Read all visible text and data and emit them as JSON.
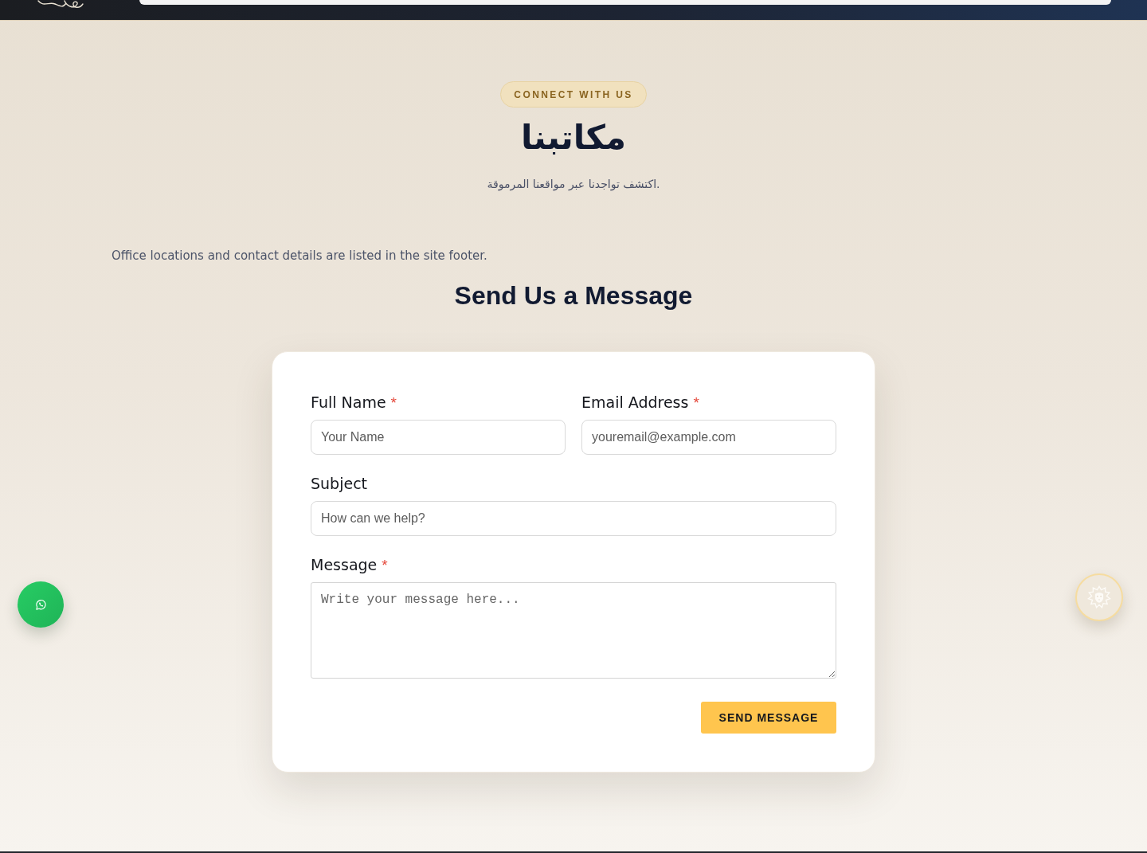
{
  "hero": {
    "badge": "CONNECT WITH US",
    "title": "مكاتبنا",
    "subtitle": "اكتشف تواجدنا عبر مواقعنا المرموقة."
  },
  "note": "Office locations and contact details are listed in the site footer.",
  "form": {
    "title": "Send Us a Message",
    "rows": [
      [
        {
          "kind": "input",
          "label": "Full Name",
          "required_mark": "*",
          "placeholder": "Your Name"
        },
        {
          "kind": "input",
          "label": "Email Address",
          "required_mark": "*",
          "placeholder": "youremail@example.com"
        }
      ],
      [
        {
          "kind": "input",
          "label": "Subject",
          "placeholder": "How can we help?"
        }
      ],
      [
        {
          "kind": "textarea",
          "label": "Message",
          "required_mark": "*",
          "placeholder": "Write your message here..."
        }
      ]
    ],
    "submit": "SEND MESSAGE"
  }
}
